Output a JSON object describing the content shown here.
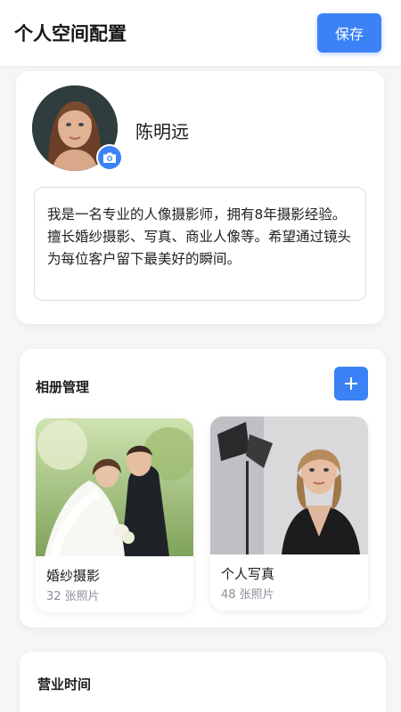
{
  "header": {
    "title": "个人空间配置",
    "save_label": "保存"
  },
  "profile": {
    "name": "陈明远",
    "bio": "我是一名专业的人像摄影师，拥有8年摄影经验。擅长婚纱摄影、写真、商业人像等。希望通过镜头为每位客户留下最美好的瞬间。",
    "camera_icon": "camera-icon"
  },
  "albums": {
    "title": "相册管理",
    "add_icon": "plus-icon",
    "items": [
      {
        "name": "婚纱摄影",
        "count": "32 张照片"
      },
      {
        "name": "个人写真",
        "count": "48 张照片"
      }
    ]
  },
  "hours": {
    "title": "营业时间"
  },
  "colors": {
    "accent": "#3b82f6",
    "background": "#f5f6f8"
  }
}
